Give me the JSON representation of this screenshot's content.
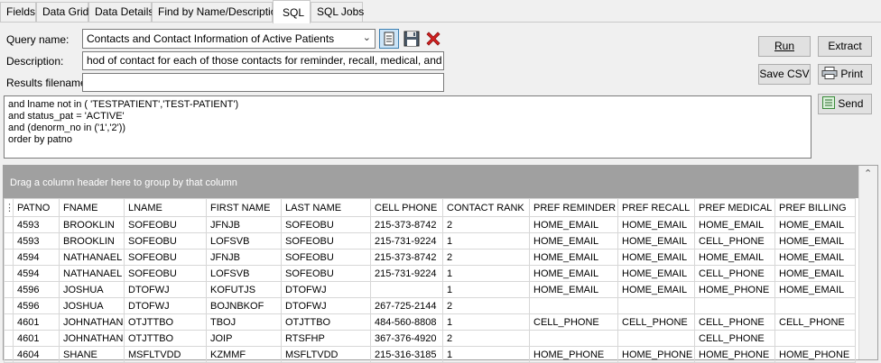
{
  "tabs": [
    {
      "label": "Fields",
      "active": false
    },
    {
      "label": "Data Grid",
      "active": false
    },
    {
      "label": "Data Details",
      "active": false
    },
    {
      "label": "Find by Name/Description",
      "active": false
    },
    {
      "label": "SQL",
      "active": true
    },
    {
      "label": "SQL Jobs",
      "active": false
    }
  ],
  "form": {
    "query_name_label": "Query name:",
    "query_name_value": "Contacts and Contact Information of Active Patients",
    "description_label": "Description:",
    "description_value": "hod of contact for each of those contacts for reminder, recall, medical, and billing.",
    "results_label": "Results filename:",
    "results_value": ""
  },
  "buttons": {
    "run": "Run",
    "extract": "Extract",
    "save_csv": "Save CSV",
    "print": "Print",
    "send": "Send"
  },
  "sql_lines": [
    "and lname not in ( 'TESTPATIENT','TEST-PATIENT')",
    "and status_pat = 'ACTIVE'",
    "and (denorm_no in ('1','2'))",
    "order by patno"
  ],
  "grid": {
    "group_hint": "Drag a column header here to group by that column",
    "columns": [
      "PATNO",
      "FNAME",
      "LNAME",
      "FIRST NAME",
      "LAST NAME",
      "CELL PHONE",
      "CONTACT RANK",
      "PREF REMINDER",
      "PREF RECALL",
      "PREF MEDICAL",
      "PREF BILLING"
    ],
    "rows": [
      [
        "4593",
        "BROOKLIN",
        "SOFEOBU",
        "JFNJB",
        "SOFEOBU",
        "215-373-8742",
        "2",
        "HOME_EMAIL",
        "HOME_EMAIL",
        "HOME_EMAIL",
        "HOME_EMAIL"
      ],
      [
        "4593",
        "BROOKLIN",
        "SOFEOBU",
        "LOFSVB",
        "SOFEOBU",
        "215-731-9224",
        "1",
        "HOME_EMAIL",
        "HOME_EMAIL",
        "CELL_PHONE",
        "HOME_EMAIL"
      ],
      [
        "4594",
        "NATHANAEL",
        "SOFEOBU",
        "JFNJB",
        "SOFEOBU",
        "215-373-8742",
        "2",
        "HOME_EMAIL",
        "HOME_EMAIL",
        "HOME_EMAIL",
        "HOME_EMAIL"
      ],
      [
        "4594",
        "NATHANAEL",
        "SOFEOBU",
        "LOFSVB",
        "SOFEOBU",
        "215-731-9224",
        "1",
        "HOME_EMAIL",
        "HOME_EMAIL",
        "CELL_PHONE",
        "HOME_EMAIL"
      ],
      [
        "4596",
        "JOSHUA",
        "DTOFWJ",
        "KOFUTJS",
        "DTOFWJ",
        "",
        "1",
        "HOME_EMAIL",
        "HOME_EMAIL",
        "HOME_PHONE",
        "HOME_EMAIL"
      ],
      [
        "4596",
        "JOSHUA",
        "DTOFWJ",
        "BOJNBKOF",
        "DTOFWJ",
        "267-725-2144",
        "2",
        "",
        "",
        "",
        ""
      ],
      [
        "4601",
        "JOHNATHAN",
        "OTJTTBO",
        "TBOJ",
        "OTJTTBO",
        "484-560-8808",
        "1",
        "CELL_PHONE",
        "CELL_PHONE",
        "CELL_PHONE",
        "CELL_PHONE"
      ],
      [
        "4601",
        "JOHNATHAN",
        "OTJTTBO",
        "JOIP",
        "RTSFHP",
        "367-376-4920",
        "2",
        "",
        "",
        "CELL_PHONE",
        ""
      ],
      [
        "4604",
        "SHANE",
        "MSFLTVDD",
        "KZMMF",
        "MSFLTVDD",
        "215-316-3185",
        "1",
        "HOME_PHONE",
        "HOME_PHONE",
        "HOME_PHONE",
        "HOME_PHONE"
      ]
    ]
  },
  "icons": {
    "list": "list-icon",
    "save": "floppy-disk-icon",
    "delete": "red-x-icon",
    "run": "play-icon",
    "print": "printer-icon",
    "send": "send-icon"
  },
  "colors": {
    "group_panel": "#a0a0a0",
    "delete_icon": "#d32020",
    "list_icon_border": "#3c7fb1"
  }
}
